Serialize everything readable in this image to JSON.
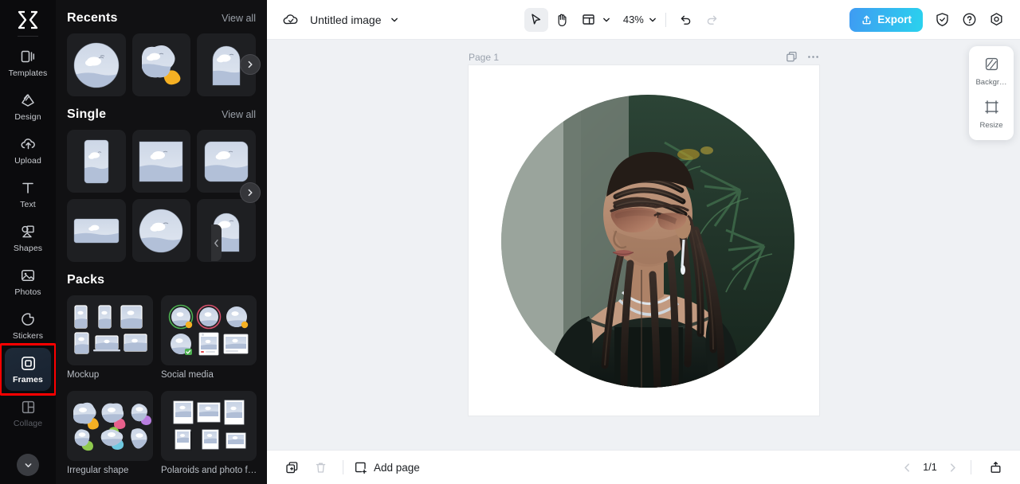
{
  "app": {
    "logo_icon": "capcut-logo-icon"
  },
  "rail": {
    "items": [
      {
        "label": "Templates",
        "icon": "templates-icon",
        "state": "normal"
      },
      {
        "label": "Design",
        "icon": "design-icon",
        "state": "normal"
      },
      {
        "label": "Upload",
        "icon": "upload-cloud-icon",
        "state": "normal"
      },
      {
        "label": "Text",
        "icon": "text-icon",
        "state": "normal"
      },
      {
        "label": "Shapes",
        "icon": "shapes-icon",
        "state": "normal"
      },
      {
        "label": "Photos",
        "icon": "photos-icon",
        "state": "normal"
      },
      {
        "label": "Stickers",
        "icon": "stickers-icon",
        "state": "normal"
      },
      {
        "label": "Frames",
        "icon": "frames-icon",
        "state": "active"
      },
      {
        "label": "Collage",
        "icon": "collage-icon",
        "state": "dim"
      }
    ],
    "expand_icon": "chevron-down-icon",
    "active_highlight_color": "#ff0000"
  },
  "panel": {
    "sections": [
      {
        "title": "Recents",
        "view_all": "View all",
        "thumbs": [
          {
            "shape": "circle",
            "name": "frame-thumb-circle"
          },
          {
            "shape": "blob",
            "name": "frame-thumb-irregular"
          },
          {
            "shape": "arch",
            "name": "frame-thumb-arch"
          }
        ]
      },
      {
        "title": "Single",
        "view_all": "View all",
        "thumbs": [
          {
            "shape": "portrait",
            "name": "frame-thumb-portrait"
          },
          {
            "shape": "square",
            "name": "frame-thumb-square"
          },
          {
            "shape": "rounded",
            "name": "frame-thumb-rounded-square"
          },
          {
            "shape": "landscape",
            "name": "frame-thumb-landscape"
          },
          {
            "shape": "circle",
            "name": "frame-thumb-circle-2"
          },
          {
            "shape": "arch",
            "name": "frame-thumb-arch-2"
          }
        ]
      }
    ],
    "packs": {
      "title": "Packs",
      "items": [
        {
          "label": "Mockup",
          "kind": "mockup"
        },
        {
          "label": "Social media",
          "kind": "social"
        },
        {
          "label": "Irregular shape",
          "kind": "irregular"
        },
        {
          "label": "Polaroids and photo f…",
          "kind": "polaroid"
        }
      ]
    },
    "next_arrow_icon": "chevron-right-icon",
    "collapse_icon": "chevron-left-icon"
  },
  "topbar": {
    "cloud_icon": "cloud-save-icon",
    "doc_title": "Untitled image",
    "title_chevron_icon": "chevron-down-icon",
    "tools": [
      {
        "name": "select-tool",
        "icon": "cursor-icon",
        "active": true
      },
      {
        "name": "hand-tool",
        "icon": "hand-icon",
        "active": false
      },
      {
        "name": "layout-tool",
        "icon": "layout-icon",
        "active": false
      }
    ],
    "layout_chevron_icon": "chevron-down-icon",
    "zoom_level": "43%",
    "zoom_chevron_icon": "chevron-down-icon",
    "undo_icon": "undo-icon",
    "redo_icon": "redo-icon",
    "redo_disabled": true,
    "export_label": "Export",
    "export_icon": "upload-icon",
    "export_color_start": "#3f9bf2",
    "export_color_end": "#2ad2ee",
    "right_icons": [
      {
        "name": "shield-icon"
      },
      {
        "name": "help-icon"
      },
      {
        "name": "settings-icon"
      }
    ]
  },
  "canvas": {
    "page_label": "Page 1",
    "duplicate_icon": "duplicate-page-icon",
    "more_icon": "more-options-icon",
    "photo_alt": "circular-cropped portrait photo"
  },
  "float_panel": {
    "items": [
      {
        "label": "Backgr…",
        "icon": "background-icon"
      },
      {
        "label": "Resize",
        "icon": "resize-icon"
      }
    ]
  },
  "bottombar": {
    "duplicate_icon": "duplicate-page-icon",
    "delete_icon": "trash-icon",
    "delete_disabled": true,
    "add_page_label": "Add page",
    "add_page_icon": "add-page-icon",
    "prev_icon": "chevron-left-icon",
    "next_icon": "chevron-right-icon",
    "page_count": "1/1",
    "present_icon": "present-icon"
  }
}
